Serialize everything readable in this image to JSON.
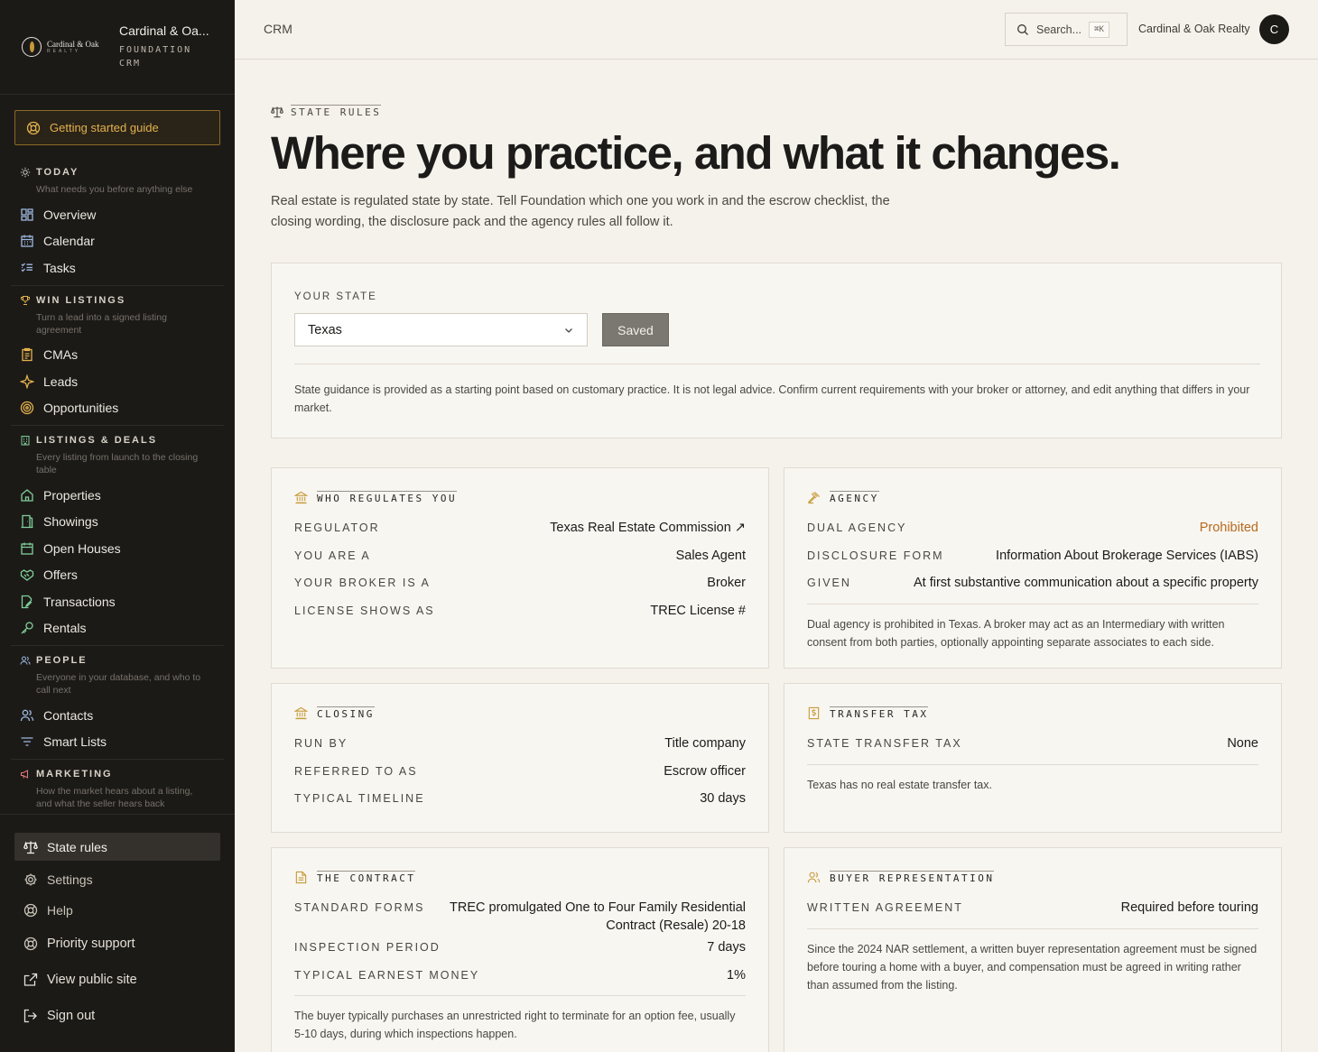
{
  "brand": {
    "logo_text": "Cardinal & Oak",
    "logo_sub": "REALTY",
    "title": "Cardinal & Oa...",
    "subtitle": "FOUNDATION CRM"
  },
  "sidebar": {
    "guide_label": "Getting started guide",
    "sections": [
      {
        "title": "TODAY",
        "desc": "What needs you before anything else",
        "items": [
          "Overview",
          "Calendar",
          "Tasks"
        ]
      },
      {
        "title": "WIN LISTINGS",
        "desc": "Turn a lead into a signed listing agreement",
        "items": [
          "CMAs",
          "Leads",
          "Opportunities"
        ]
      },
      {
        "title": "LISTINGS & DEALS",
        "desc": "Every listing from launch to the closing table",
        "items": [
          "Properties",
          "Showings",
          "Open Houses",
          "Offers",
          "Transactions",
          "Rentals"
        ]
      },
      {
        "title": "PEOPLE",
        "desc": "Everyone in your database, and who to call next",
        "items": [
          "Contacts",
          "Smart Lists"
        ]
      },
      {
        "title": "MARKETING",
        "desc": "How the market hears about a listing, and what the seller hears back",
        "items": []
      }
    ],
    "bottom": {
      "state_rules": "State rules",
      "settings": "Settings",
      "help": "Help",
      "priority_support": "Priority support",
      "view_public_site": "View public site",
      "sign_out": "Sign out"
    }
  },
  "header": {
    "breadcrumb": "CRM",
    "search_placeholder": "Search...",
    "search_shortcut": "⌘K",
    "org_name": "Cardinal & Oak Realty",
    "avatar_initial": "C"
  },
  "page": {
    "eyebrow": "STATE RULES",
    "headline": "Where you practice, and what it changes.",
    "lede": "Real estate is regulated state by state. Tell Foundation which one you work in and the escrow checklist, the closing wording, the disclosure pack and the agency rules all follow it.",
    "state_label": "YOUR STATE",
    "state_value": "Texas",
    "saved_label": "Saved",
    "state_note": "State guidance is provided as a starting point based on customary practice. It is not legal advice. Confirm current requirements with your broker or attorney, and edit anything that differs in your market."
  },
  "cards": {
    "regulator": {
      "title": "WHO REGULATES YOU",
      "rows": [
        {
          "k": "REGULATOR",
          "v": "Texas Real Estate Commission ↗"
        },
        {
          "k": "YOU ARE A",
          "v": "Sales Agent"
        },
        {
          "k": "YOUR BROKER IS A",
          "v": "Broker"
        },
        {
          "k": "LICENSE SHOWS AS",
          "v": "TREC License #"
        }
      ]
    },
    "agency": {
      "title": "AGENCY",
      "rows": [
        {
          "k": "DUAL AGENCY",
          "v": "Prohibited"
        },
        {
          "k": "DISCLOSURE FORM",
          "v": "Information About Brokerage Services (IABS)"
        },
        {
          "k": "GIVEN",
          "v": "At first substantive communication about a specific property"
        }
      ],
      "note": "Dual agency is prohibited in Texas. A broker may act as an Intermediary with written consent from both parties, optionally appointing separate associates to each side."
    },
    "closing": {
      "title": "CLOSING",
      "rows": [
        {
          "k": "RUN BY",
          "v": "Title company"
        },
        {
          "k": "REFERRED TO AS",
          "v": "Escrow officer"
        },
        {
          "k": "TYPICAL TIMELINE",
          "v": "30 days"
        }
      ]
    },
    "transfer": {
      "title": "TRANSFER TAX",
      "rows": [
        {
          "k": "STATE TRANSFER TAX",
          "v": "None"
        }
      ],
      "note": "Texas has no real estate transfer tax."
    },
    "contract": {
      "title": "THE CONTRACT",
      "rows": [
        {
          "k": "STANDARD FORMS",
          "v": "TREC promulgated One to Four Family Residential Contract (Resale) 20-18"
        },
        {
          "k": "INSPECTION PERIOD",
          "v": "7 days"
        },
        {
          "k": "TYPICAL EARNEST MONEY",
          "v": "1%"
        }
      ],
      "note": "The buyer typically purchases an unrestricted right to terminate for an option fee, usually 5-10 days, during which inspections happen."
    },
    "buyer": {
      "title": "BUYER REPRESENTATION",
      "rows": [
        {
          "k": "WRITTEN AGREEMENT",
          "v": "Required before touring"
        }
      ],
      "note": "Since the 2024 NAR settlement, a written buyer representation agreement must be signed before touring a home with a buyer, and compensation must be agreed in writing rather than assumed from the listing."
    }
  },
  "colors": {
    "accent": "#c79a3a",
    "warning": "#b76a1e",
    "sidebar_bg": "#1c1a17",
    "page_bg": "#f5f2ec"
  }
}
